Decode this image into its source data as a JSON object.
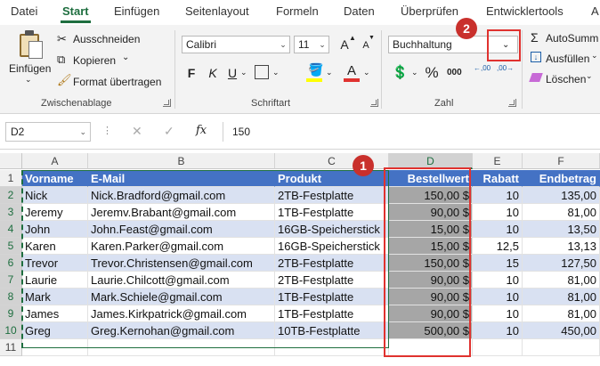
{
  "ribbon_tabs": [
    "Datei",
    "Start",
    "Einfügen",
    "Seitenlayout",
    "Formeln",
    "Daten",
    "Überprüfen",
    "Entwicklertools",
    "A"
  ],
  "clipboard": {
    "paste_label": "Einfügen",
    "cut_label": "Ausschneiden",
    "copy_label": "Kopieren",
    "format_painter_label": "Format übertragen",
    "group_label": "Zwischenablage"
  },
  "font": {
    "font_name": "Calibri",
    "font_size": "11",
    "grow": "A",
    "shrink": "A",
    "bold": "F",
    "italic": "K",
    "underline": "U",
    "font_color": "A",
    "group_label": "Schriftart"
  },
  "number": {
    "format": "Buchhaltung",
    "percent": "%",
    "comma": "000",
    "inc_decimal": "←,00",
    "dec_decimal": ",00→",
    "group_label": "Zahl"
  },
  "editing": {
    "autosum_label": "AutoSumm",
    "fill_label": "Ausfüllen",
    "clear_label": "Löschen"
  },
  "formula_bar": {
    "name_box": "D2",
    "formula": "150",
    "fx": "fx"
  },
  "columns": [
    "A",
    "B",
    "C",
    "D",
    "E",
    "F"
  ],
  "table": {
    "headers": [
      "Vorname",
      "E-Mail",
      "Produkt",
      "Bestellwert",
      "Rabatt",
      "Endbetrag"
    ],
    "rows": [
      [
        "Nick",
        "Nick.Bradford@gmail.com",
        "2TB-Festplatte",
        "150,00 $",
        "10",
        "135,00"
      ],
      [
        "Jeremy",
        "Jeremv.Brabant@gmail.com",
        "1TB-Festplatte",
        "90,00 $",
        "10",
        "81,00"
      ],
      [
        "John",
        "John.Feast@gmail.com",
        "16GB-Speicherstick",
        "15,00 $",
        "10",
        "13,50"
      ],
      [
        "Karen",
        "Karen.Parker@gmail.com",
        "16GB-Speicherstick",
        "15,00 $",
        "12,5",
        "13,13"
      ],
      [
        "Trevor",
        "Trevor.Christensen@gmail.com",
        "2TB-Festplatte",
        "150,00 $",
        "15",
        "127,50"
      ],
      [
        "Laurie",
        "Laurie.Chilcott@gmail.com",
        "2TB-Festplatte",
        "90,00 $",
        "10",
        "81,00"
      ],
      [
        "Mark",
        "Mark.Schiele@gmail.com",
        "1TB-Festplatte",
        "90,00 $",
        "10",
        "81,00"
      ],
      [
        "James",
        "James.Kirkpatrick@gmail.com",
        "1TB-Festplatte",
        "90,00 $",
        "10",
        "81,00"
      ],
      [
        "Greg",
        " Greg.Kernohan@gmail.com",
        "10TB-Festplatte",
        "500,00 $",
        "10",
        "450,00"
      ]
    ]
  },
  "row_numbers": [
    "1",
    "2",
    "3",
    "4",
    "5",
    "6",
    "7",
    "8",
    "9",
    "10",
    "11"
  ],
  "callouts": {
    "one": "1",
    "two": "2"
  },
  "colors": {
    "accent": "#1e6e3f",
    "header_blue": "#4472c4",
    "band": "#d9e1f2",
    "selection": "#a6a6a6",
    "callout_red": "#c9302c"
  }
}
